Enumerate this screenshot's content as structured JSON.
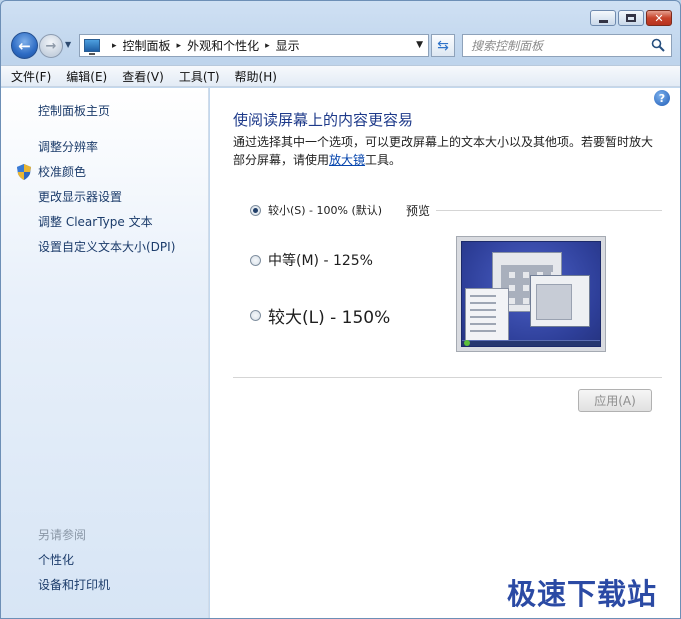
{
  "window": {
    "accent": "#1e3a8a"
  },
  "nav": {
    "back_glyph": "←",
    "forward_glyph": "→",
    "recent_glyph": "▼",
    "breadcrumbs": [
      "控制面板",
      "外观和个性化",
      "显示"
    ],
    "crumb_sep": "▸",
    "dropdown_glyph": "▼",
    "refresh_glyph": "⇆",
    "search_placeholder": "搜索控制面板"
  },
  "menubar": [
    "文件(F)",
    "编辑(E)",
    "查看(V)",
    "工具(T)",
    "帮助(H)"
  ],
  "sidebar": {
    "home": "控制面板主页",
    "tasks": [
      "调整分辨率",
      "校准颜色",
      "更改显示器设置",
      "调整 ClearType 文本",
      "设置自定义文本大小(DPI)"
    ],
    "see_also_heading": "另请参阅",
    "see_also": [
      "个性化",
      "设备和打印机"
    ]
  },
  "main": {
    "help_glyph": "?",
    "title": "使阅读屏幕上的内容更容易",
    "desc_prefix": "通过选择其中一个选项，可以更改屏幕上的文本大小以及其他项。若要暂时放大部分屏幕，请使用",
    "desc_link": "放大镜",
    "desc_suffix": "工具。",
    "options": [
      {
        "label": "较小(S) - 100% (默认)",
        "checked": true
      },
      {
        "label": "中等(M) - 125%",
        "checked": false
      },
      {
        "label": "较大(L) - 150%",
        "checked": false
      }
    ],
    "preview_label": "预览",
    "apply_label": "应用(A)"
  },
  "caption": {
    "close_glyph": "✕"
  },
  "watermark": "极速下载站"
}
